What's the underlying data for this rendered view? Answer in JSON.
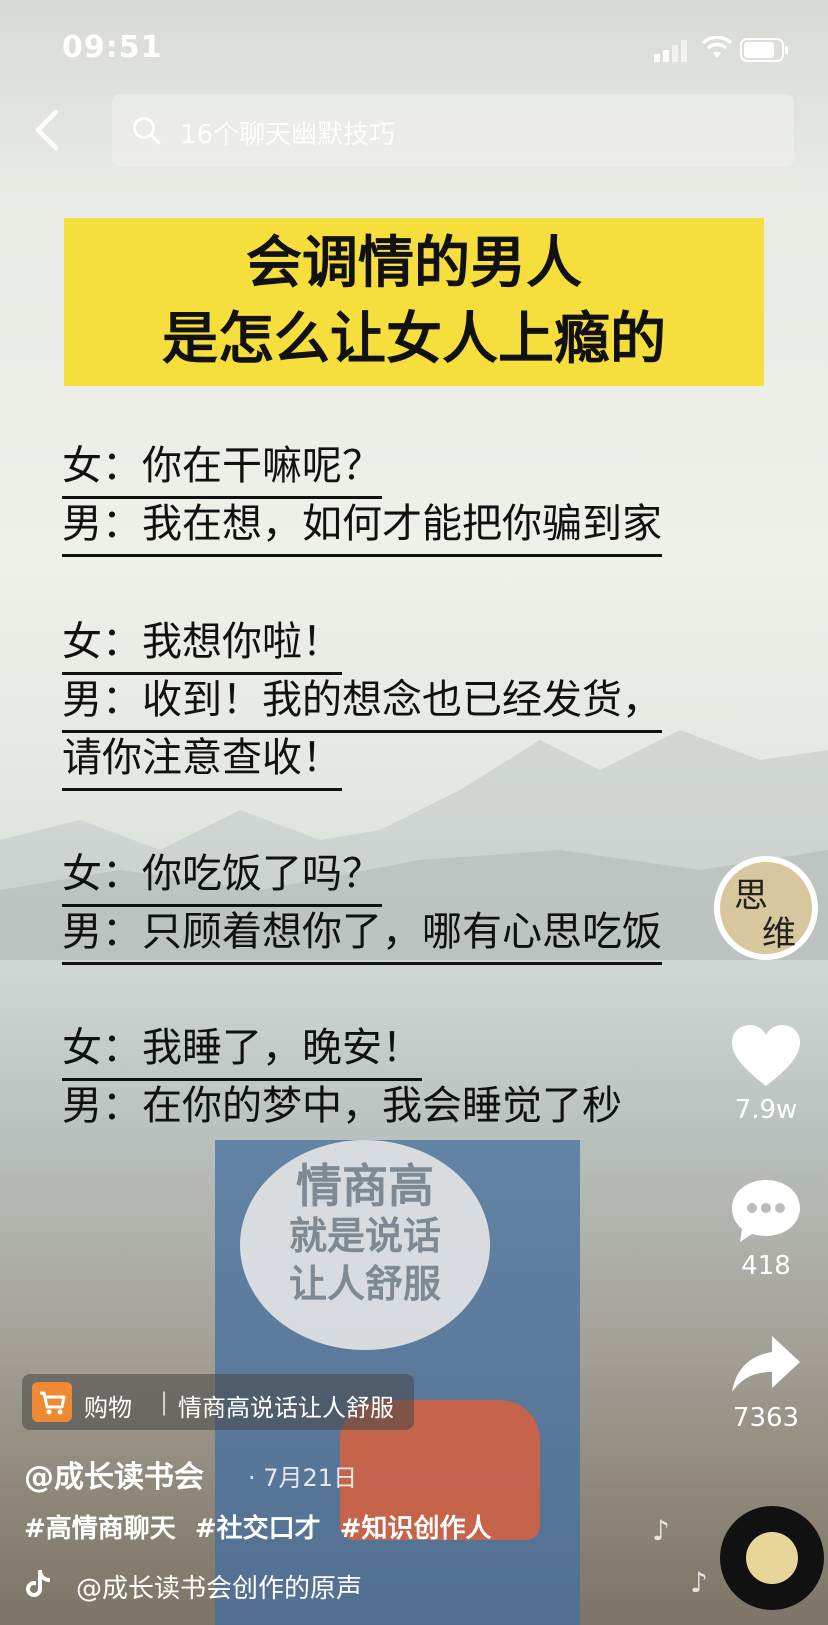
{
  "status": {
    "time": "09:51"
  },
  "search": {
    "placeholder": "16个聊天幽默技巧"
  },
  "banner": {
    "line1": "会调情的男人",
    "line2": "是怎么让女人上瘾的"
  },
  "conversation": [
    "女：你在干嘛呢？",
    "男：我在想，如何才能把你骗到家",
    "女：我想你啦！",
    "男：收到！我的想念也已经发货，",
    "请你注意查收！",
    "女：你吃饭了吗？",
    "男：只顾着想你了，哪有心思吃饭",
    "女：我睡了，晚安！",
    "男：在你的梦中，我会睡觉了秒"
  ],
  "book_cover": {
    "line1": "情商高",
    "line2": "就是说话",
    "line3": "让人舒服"
  },
  "avatar": {
    "char1": "思",
    "char2": "维"
  },
  "actions": {
    "likes": "7.9w",
    "comments": "418",
    "shares": "7363"
  },
  "shopping": {
    "label": "购物",
    "separator": "|",
    "title": "情商高说话让人舒服"
  },
  "post": {
    "author": "@成长读书会",
    "date": "· 7月21日",
    "tags": [
      "#高情商聊天",
      "#社交口才",
      "#知识创作人"
    ],
    "sound": "@成长读书会创作的原声"
  }
}
